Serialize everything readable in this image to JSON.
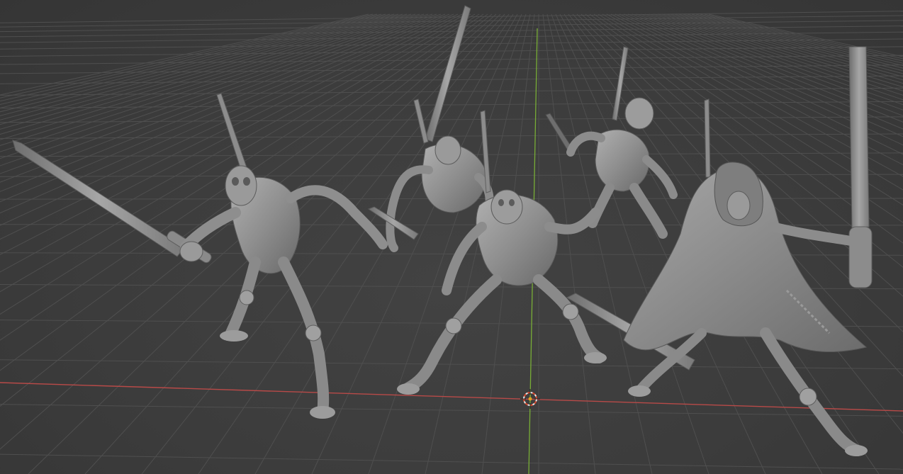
{
  "viewport": {
    "background": "#3a3a3a",
    "grid_color": "#4f4f4f",
    "x_axis_color": "#c0504d",
    "y_axis_color": "#7db23a",
    "model_color": "#8f8f8f",
    "model_shade": "#6b6b6b",
    "model_highlight": "#b4b4b4",
    "cursor_color": "#e06030"
  },
  "scene_objects": [
    {
      "name": "warrior-figure-left",
      "icon": "mesh-icon"
    },
    {
      "name": "warrior-figure-back",
      "icon": "mesh-icon"
    },
    {
      "name": "warrior-figure-center",
      "icon": "mesh-icon"
    },
    {
      "name": "warrior-figure-right-back",
      "icon": "mesh-icon"
    },
    {
      "name": "warrior-figure-hooded",
      "icon": "mesh-icon"
    }
  ],
  "cursor": {
    "icon": "3d-cursor-icon"
  }
}
